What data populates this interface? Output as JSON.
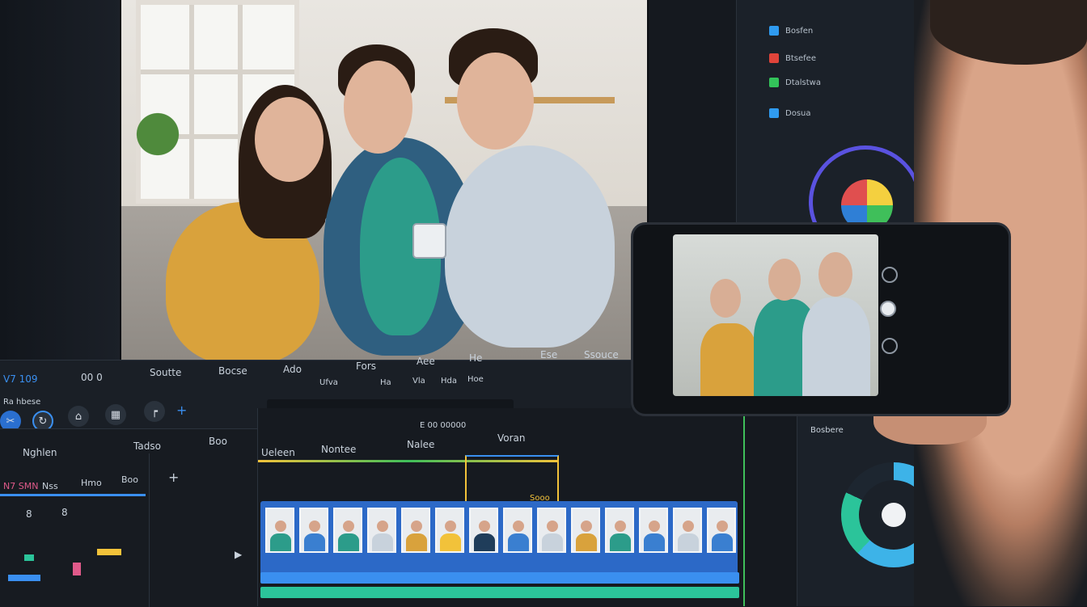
{
  "toolbar": {
    "timecode": "V7 109",
    "items": [
      "Soutte",
      "Bocse",
      "Ado",
      "Fors",
      "Aee",
      "He",
      "Ese",
      "Ssouce"
    ],
    "sub_items": [
      "Ufva",
      "Ha",
      "Vla",
      "Hda",
      "Hoe"
    ],
    "left_label": "Ra hbese",
    "scale": "00 0"
  },
  "left_panel": {
    "title": "Nghlen",
    "col2": "Tadso",
    "col3": "Boo",
    "row_items": [
      "N7 SMN",
      "Nss",
      "Hmo",
      "Boo"
    ],
    "numbers": [
      "8",
      "8"
    ]
  },
  "timeline": {
    "labels": [
      "Ueleen",
      "Nontee",
      "Nalee",
      "Voran"
    ],
    "marker": "Sooo",
    "top_label": "E 00 00000"
  },
  "right_panel": {
    "rows": [
      "Bosfen",
      "Btsefee",
      "Dtalstwa",
      "Dosua"
    ],
    "bottom_title": "Bosbere"
  },
  "colors": {
    "accent": "#3a8ff0",
    "timeline_bar": "#2c69c7",
    "wheel_ring": "#5a52e0",
    "progress": "#3db3e8"
  },
  "icons": [
    "scissor-icon",
    "crop-icon",
    "plus-icon",
    "play-icon",
    "gear-icon"
  ]
}
